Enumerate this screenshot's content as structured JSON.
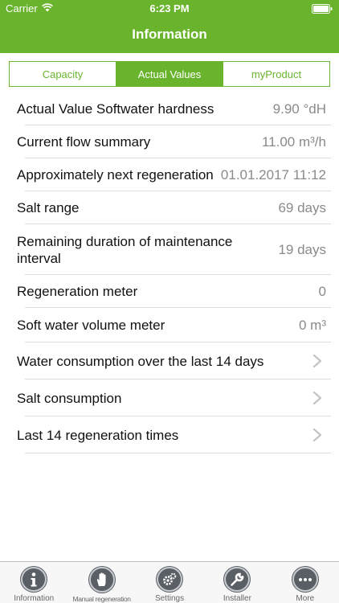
{
  "status_bar": {
    "carrier": "Carrier",
    "time": "6:23 PM"
  },
  "nav": {
    "title": "Information"
  },
  "segments": [
    {
      "label": "Capacity",
      "active": false
    },
    {
      "label": "Actual Values",
      "active": true
    },
    {
      "label": "myProduct",
      "active": false
    }
  ],
  "rows": [
    {
      "label": "Actual Value Softwater hardness",
      "value": "9.90 °dH"
    },
    {
      "label": "Current flow summary",
      "value": "11.00 m³/h"
    },
    {
      "label": "Approximately next regeneration",
      "value": "01.01.2017 11:12"
    },
    {
      "label": "Salt range",
      "value": "69 days"
    },
    {
      "label": "Remaining duration of maintenance interval",
      "value": "19 days"
    },
    {
      "label": "Regeneration meter",
      "value": "0"
    },
    {
      "label": "Soft water volume meter",
      "value": "0 m³"
    },
    {
      "label": "Water consumption over the last 14 days",
      "value": ""
    },
    {
      "label": "Salt consumption",
      "value": ""
    },
    {
      "label": "Last 14 regeneration times",
      "value": ""
    }
  ],
  "tabs": [
    {
      "label": "Information",
      "icon": "info-icon"
    },
    {
      "label": "Manual regeneration",
      "icon": "hand-icon"
    },
    {
      "label": "Settings",
      "icon": "gears-icon"
    },
    {
      "label": "Installer",
      "icon": "wrench-icon"
    },
    {
      "label": "More",
      "icon": "more-icon"
    }
  ],
  "colors": {
    "accent": "#6ab42d",
    "row_value": "#8a8a8a",
    "tab_icon": "#5a5f66"
  }
}
